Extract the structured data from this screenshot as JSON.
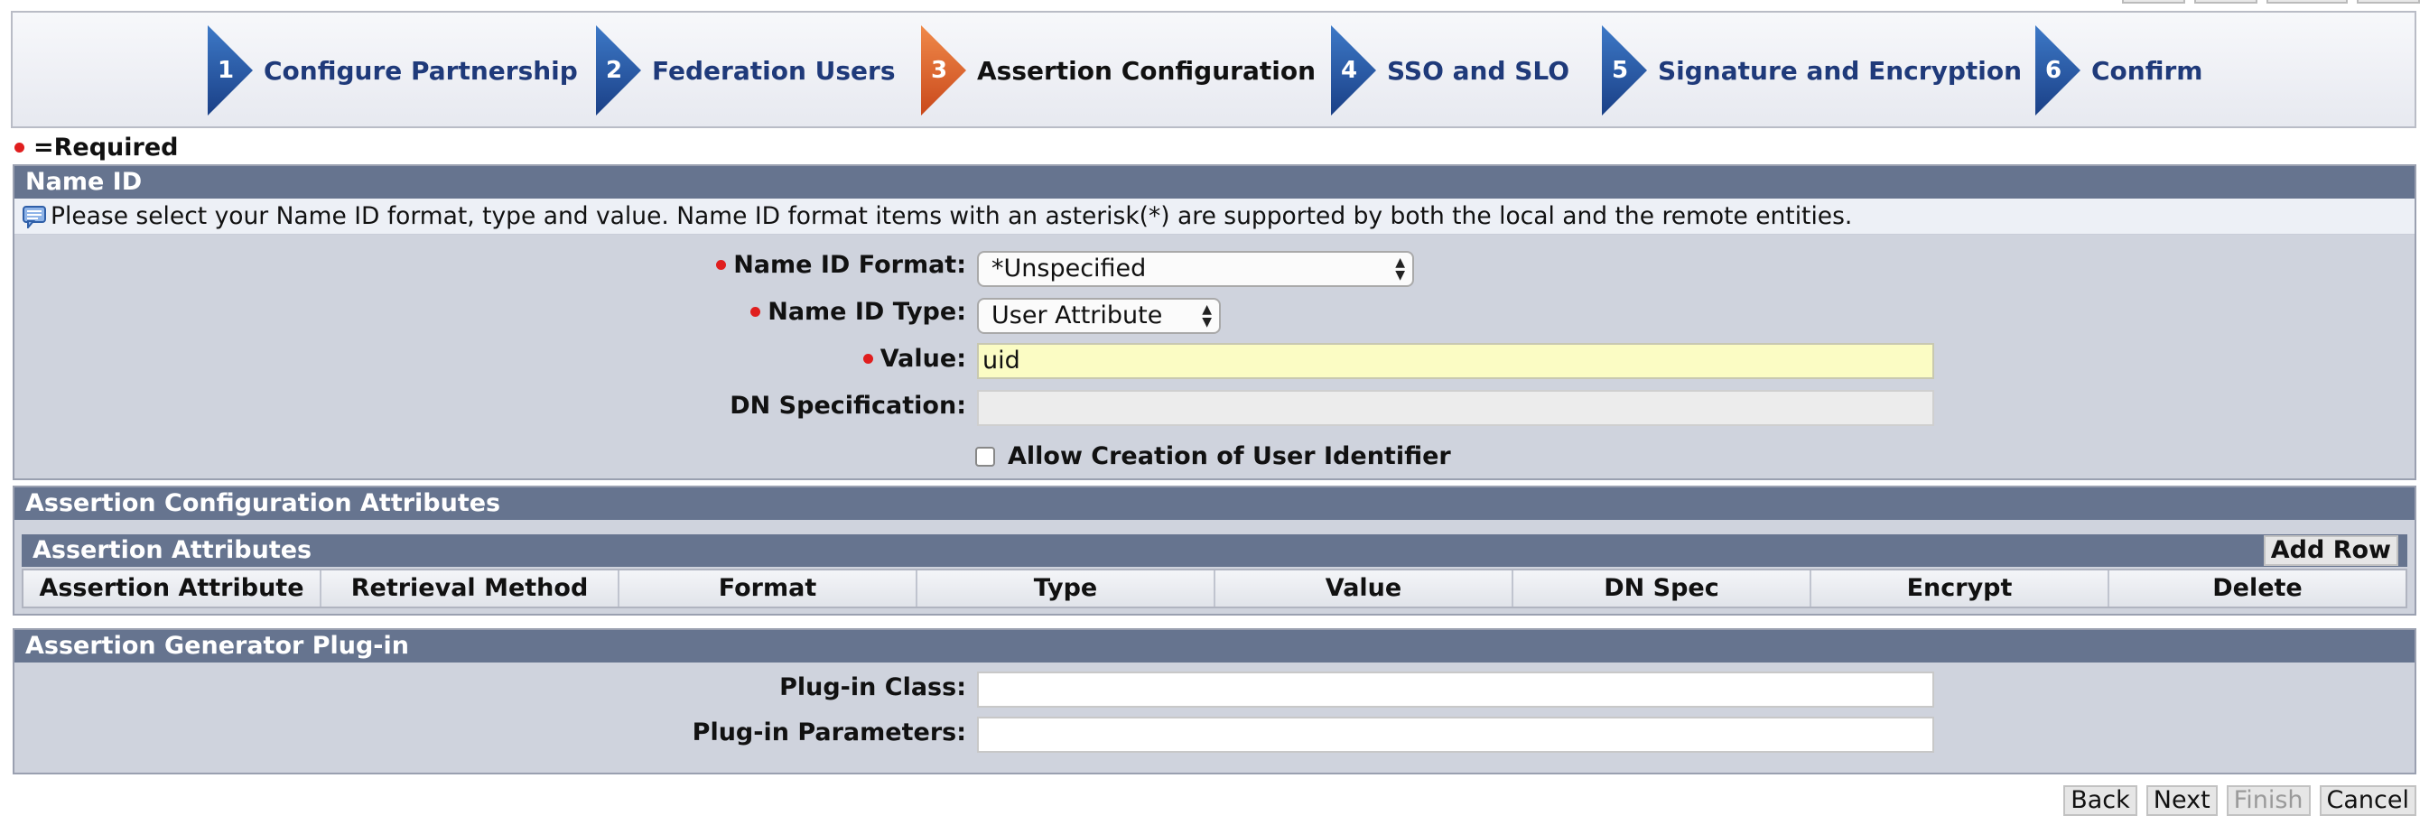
{
  "wizard": {
    "steps": [
      {
        "number": "1",
        "label": "Configure Partnership",
        "state": "pending"
      },
      {
        "number": "2",
        "label": "Federation Users",
        "state": "pending"
      },
      {
        "number": "3",
        "label": "Assertion Configuration",
        "state": "active"
      },
      {
        "number": "4",
        "label": "SSO and SLO",
        "state": "pending"
      },
      {
        "number": "5",
        "label": "Signature and Encryption",
        "state": "pending"
      },
      {
        "number": "6",
        "label": "Confirm",
        "state": "pending"
      }
    ]
  },
  "required_note": "=Required",
  "name_id": {
    "title": "Name ID",
    "info": "Please select your Name ID format, type and value. Name ID format items with an asterisk(*) are supported by both the local and the remote entities.",
    "format_label": "Name ID Format:",
    "format_value": "*Unspecified",
    "type_label": "Name ID Type:",
    "type_value": "User Attribute",
    "value_label": "Value:",
    "value_value": "uid",
    "dn_label": "DN Specification:",
    "dn_value": "",
    "allow_label": "Allow Creation of User Identifier"
  },
  "assertion_config": {
    "title": "Assertion Configuration Attributes",
    "sub_title": "Assertion Attributes",
    "add_row": "Add Row",
    "columns": [
      "Assertion Attribute",
      "Retrieval Method",
      "Format",
      "Type",
      "Value",
      "DN Spec",
      "Encrypt",
      "Delete"
    ]
  },
  "plugin": {
    "title": "Assertion Generator Plug-in",
    "class_label": "Plug-in Class:",
    "class_value": "",
    "params_label": "Plug-in Parameters:",
    "params_value": ""
  },
  "footer": {
    "back": "Back",
    "next": "Next",
    "finish": "Finish",
    "cancel": "Cancel"
  },
  "colors": {
    "step_blue": "#1f4f9a",
    "step_active": "#e0612a",
    "panel_header": "#66748f",
    "panel_bg": "#cfd3dd",
    "required_dot": "#e01e1e",
    "value_field": "#fbfcc4"
  },
  "icons": [
    "step-arrow-icon",
    "info-comment-icon",
    "required-dot-icon",
    "select-caret-icon"
  ]
}
